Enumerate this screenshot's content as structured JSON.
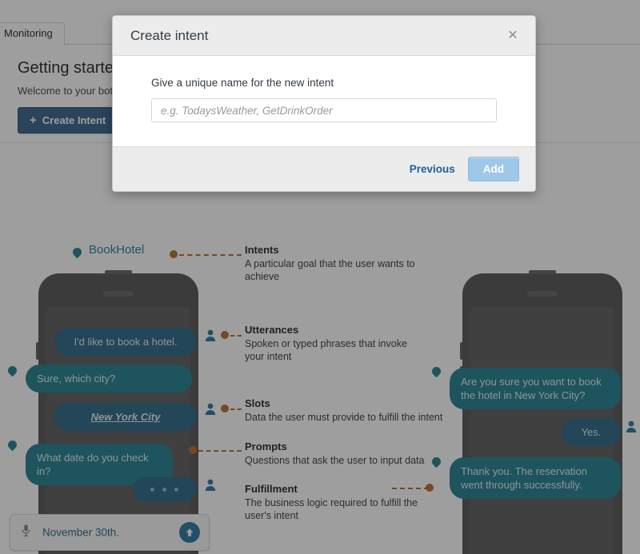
{
  "page": {
    "tab_label": "Monitoring",
    "title": "Getting started with your bot",
    "welcome": "Welcome to your bot. To build your bot, use the left navigation.",
    "create_intent_button": "Create Intent",
    "plus_glyph": "+"
  },
  "diagram": {
    "bot_label": "BookHotel",
    "left_phone": {
      "messages": [
        {
          "text": "I'd like to book a hotel.",
          "from": "user"
        },
        {
          "text": "Sure, which city?",
          "from": "bot"
        },
        {
          "text": "New York City",
          "from": "user",
          "style": "italic-underline"
        },
        {
          "text": "What date do you check in?",
          "from": "bot"
        }
      ],
      "composer": {
        "value": "November 30th.",
        "mic_icon": "microphone-icon",
        "send_icon": "arrow-up-circle-icon"
      }
    },
    "right_phone": {
      "messages": [
        {
          "text": "Are you sure you want to book the hotel in New York City?",
          "from": "bot"
        },
        {
          "text": "Yes.",
          "from": "user"
        },
        {
          "text": "Thank you. The reservation went through successfully.",
          "from": "bot"
        }
      ]
    },
    "annotations": [
      {
        "title": "Intents",
        "desc": "A particular goal that the user wants to achieve"
      },
      {
        "title": "Utterances",
        "desc": "Spoken or typed phrases that invoke your intent"
      },
      {
        "title": "Slots",
        "desc": "Data the user must provide to fulfill the intent"
      },
      {
        "title": "Prompts",
        "desc": "Questions that ask the user to input data"
      },
      {
        "title": "Fulfillment",
        "desc": "The business logic required to fulfill the user's intent"
      }
    ],
    "colors": {
      "teal": "#17788a",
      "user_blue": "#1f5f80",
      "orange": "#b5641c",
      "phone": "#4b4b4b"
    }
  },
  "modal": {
    "title": "Create intent",
    "close_glyph": "✕",
    "field_label": "Give a unique name for the new intent",
    "input_value": "",
    "input_placeholder": "e.g. TodaysWeather, GetDrinkOrder",
    "previous_label": "Previous",
    "add_label": "Add"
  }
}
